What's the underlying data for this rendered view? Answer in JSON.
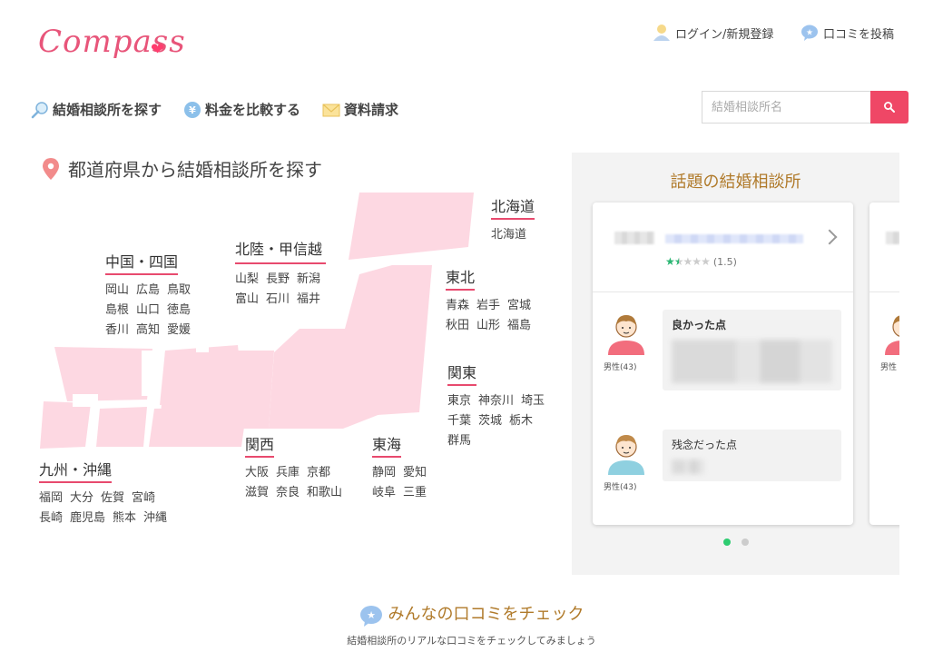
{
  "header": {
    "logo_text": "Compass",
    "login_label": "ログイン/新規登録",
    "post_review_label": "口コミを投稿"
  },
  "nav": {
    "items": [
      {
        "label": "結婚相談所を探す",
        "icon": "magnifier-icon"
      },
      {
        "label": "料金を比較する",
        "icon": "yen-coin-icon"
      },
      {
        "label": "資料請求",
        "icon": "envelope-icon"
      }
    ]
  },
  "search": {
    "placeholder": "結婚相談所名"
  },
  "prefecture_section": {
    "title": "都道府県から結婚相談所を探す",
    "regions": [
      {
        "name": "北海道",
        "prefectures": [
          "北海道"
        ]
      },
      {
        "name": "東北",
        "prefectures": [
          "青森",
          "岩手",
          "宮城",
          "秋田",
          "山形",
          "福島"
        ]
      },
      {
        "name": "関東",
        "prefectures": [
          "東京",
          "神奈川",
          "埼玉",
          "千葉",
          "茨城",
          "栃木",
          "群馬"
        ]
      },
      {
        "name": "北陸・甲信越",
        "prefectures": [
          "山梨",
          "長野",
          "新潟",
          "富山",
          "石川",
          "福井"
        ]
      },
      {
        "name": "中国・四国",
        "prefectures": [
          "岡山",
          "広島",
          "鳥取",
          "島根",
          "山口",
          "徳島",
          "香川",
          "高知",
          "愛媛"
        ]
      },
      {
        "name": "関西",
        "prefectures": [
          "大阪",
          "兵庫",
          "京都",
          "滋賀",
          "奈良",
          "和歌山"
        ]
      },
      {
        "name": "東海",
        "prefectures": [
          "静岡",
          "愛知",
          "岐阜",
          "三重"
        ]
      },
      {
        "name": "九州・沖縄",
        "prefectures": [
          "福岡",
          "大分",
          "佐賀",
          "宮崎",
          "長崎",
          "鹿児島",
          "熊本",
          "沖縄"
        ]
      }
    ]
  },
  "trending": {
    "title": "話題の結婚相談所",
    "card": {
      "rating": 1.5,
      "rating_text": "(1.5)",
      "reviews": [
        {
          "gender": "男性(43)",
          "label": "良かった点"
        },
        {
          "gender": "男性(43)",
          "label": "残念だった点"
        }
      ]
    },
    "card2_gender": "男性",
    "slides_total": 2,
    "slide_active": 1
  },
  "reviews_section": {
    "title": "みんなの口コミをチェック",
    "subtitle": "結婚相談所のリアルな口コミをチェックしてみましょう"
  },
  "colors": {
    "accent": "#ef4766",
    "map_fill": "#fdd8e2",
    "gold": "#b07a2a",
    "dot_active": "#2ecc71"
  }
}
